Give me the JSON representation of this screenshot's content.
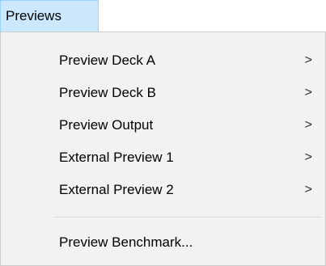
{
  "menu": {
    "title": "Previews",
    "items": [
      {
        "label": "Preview Deck A",
        "submenu_arrow": ">"
      },
      {
        "label": "Preview Deck B",
        "submenu_arrow": ">"
      },
      {
        "label": "Preview Output",
        "submenu_arrow": ">"
      },
      {
        "label": "External Preview 1",
        "submenu_arrow": ">"
      },
      {
        "label": "External Preview 2",
        "submenu_arrow": ">"
      }
    ],
    "footer_item": {
      "label": "Preview Benchmark..."
    }
  },
  "colors": {
    "menubar_highlight": "#cce8ff",
    "menubar_border": "#99d1ff",
    "menu_background": "#f2f2f2",
    "separator": "#d9d9d9"
  },
  "icons": {
    "submenu": "chevron-right-icon"
  }
}
